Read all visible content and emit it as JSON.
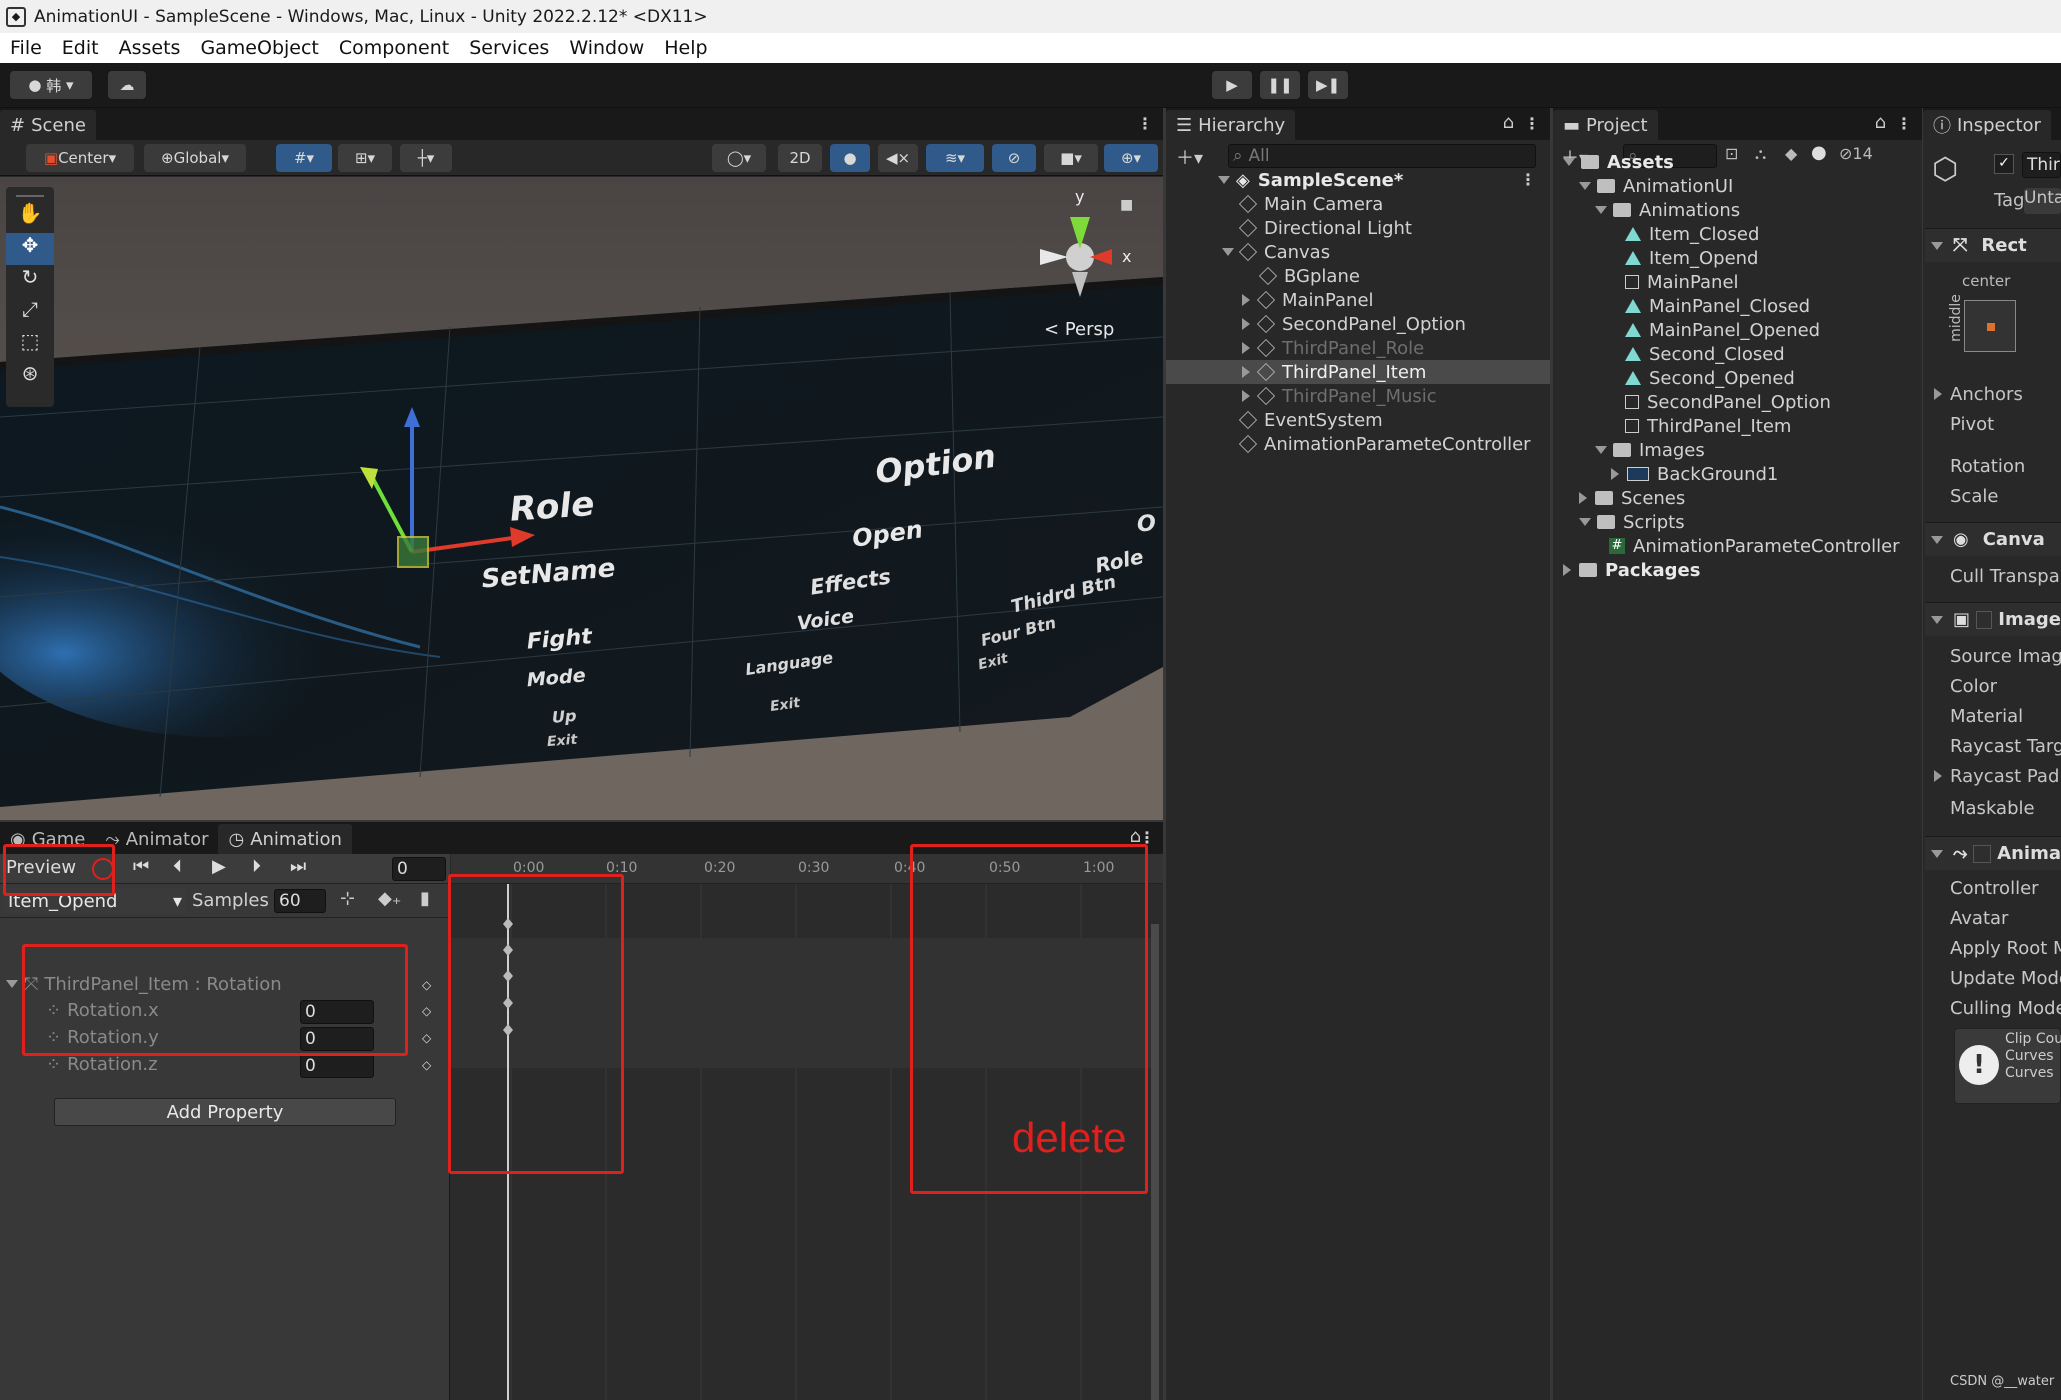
{
  "window": {
    "title": "AnimationUI - SampleScene - Windows, Mac, Linux - Unity 2022.2.12* <DX11>"
  },
  "menu": [
    "File",
    "Edit",
    "Assets",
    "GameObject",
    "Component",
    "Services",
    "Window",
    "Help"
  ],
  "toolbar": {
    "account": "韩",
    "play_icon": "play-icon",
    "pause_icon": "pause-icon",
    "step_icon": "step-icon"
  },
  "scene": {
    "tab": "Scene",
    "pivot": "Center",
    "space": "Global",
    "mode2d": "2D",
    "persp": "Persp",
    "world_labels": [
      "Role",
      "SetName",
      "Fight",
      "Mode",
      "Up",
      "Exit",
      "Option",
      "Open",
      "Effects",
      "Voice",
      "Language",
      "Exit",
      "Role",
      "Thidrd Btn",
      "Four Btn",
      "Exit",
      "O"
    ]
  },
  "bottom_tabs": {
    "game": "Game",
    "animator": "Animator",
    "animation": "Animation"
  },
  "animation": {
    "preview": "Preview",
    "frame": "0",
    "clip": "Item_Opend",
    "samples_label": "Samples",
    "samples": "60",
    "timeline_ticks": [
      "0:00",
      "0:10",
      "0:20",
      "0:30",
      "0:40",
      "0:50",
      "1:00"
    ],
    "group": "ThirdPanel_Item : Rotation",
    "properties": [
      {
        "name": "Rotation.x",
        "value": "0"
      },
      {
        "name": "Rotation.y",
        "value": "0"
      },
      {
        "name": "Rotation.z",
        "value": "0"
      }
    ],
    "add_property": "Add Property",
    "annotation": "delete"
  },
  "hierarchy": {
    "tab": "Hierarchy",
    "search": "All",
    "scene": "SampleScene*",
    "items": [
      {
        "label": "Main Camera",
        "indent": 0,
        "state": "normal"
      },
      {
        "label": "Directional Light",
        "indent": 0,
        "state": "normal"
      },
      {
        "label": "Canvas",
        "indent": 0,
        "state": "open"
      },
      {
        "label": "BGplane",
        "indent": 1,
        "state": "normal"
      },
      {
        "label": "MainPanel",
        "indent": 1,
        "state": "closed"
      },
      {
        "label": "SecondPanel_Option",
        "indent": 1,
        "state": "closed"
      },
      {
        "label": "ThirdPanel_Role",
        "indent": 1,
        "state": "disabled"
      },
      {
        "label": "ThirdPanel_Item",
        "indent": 1,
        "state": "selected"
      },
      {
        "label": "ThirdPanel_Music",
        "indent": 1,
        "state": "disabled"
      },
      {
        "label": "EventSystem",
        "indent": 0,
        "state": "normal"
      },
      {
        "label": "AnimationParameteController",
        "indent": 0,
        "state": "normal"
      }
    ]
  },
  "project": {
    "tab": "Project",
    "hidden_count": "14",
    "items": [
      {
        "label": "Assets",
        "indent": 0,
        "icon": "folder",
        "bold": true
      },
      {
        "label": "AnimationUI",
        "indent": 1,
        "icon": "folder"
      },
      {
        "label": "Animations",
        "indent": 2,
        "icon": "folder"
      },
      {
        "label": "Item_Closed",
        "indent": 3,
        "icon": "anim"
      },
      {
        "label": "Item_Opend",
        "indent": 3,
        "icon": "anim"
      },
      {
        "label": "MainPanel",
        "indent": 3,
        "icon": "ctrl"
      },
      {
        "label": "MainPanel_Closed",
        "indent": 3,
        "icon": "anim"
      },
      {
        "label": "MainPanel_Opened",
        "indent": 3,
        "icon": "anim"
      },
      {
        "label": "Second_Closed",
        "indent": 3,
        "icon": "anim"
      },
      {
        "label": "Second_Opened",
        "indent": 3,
        "icon": "anim"
      },
      {
        "label": "SecondPanel_Option",
        "indent": 3,
        "icon": "ctrl"
      },
      {
        "label": "ThirdPanel_Item",
        "indent": 3,
        "icon": "ctrl"
      },
      {
        "label": "Images",
        "indent": 2,
        "icon": "folder"
      },
      {
        "label": "BackGround1",
        "indent": 3,
        "icon": "image"
      },
      {
        "label": "Scenes",
        "indent": 1,
        "icon": "folder"
      },
      {
        "label": "Scripts",
        "indent": 1,
        "icon": "folder"
      },
      {
        "label": "AnimationParameteController",
        "indent": 2,
        "icon": "script"
      },
      {
        "label": "Packages",
        "indent": 0,
        "icon": "folder",
        "bold": true
      }
    ]
  },
  "inspector": {
    "tab": "Inspector",
    "name": "Thir",
    "tag_label": "Tag",
    "tag_value": "Unta",
    "rect_title": "Rect",
    "center": "center",
    "middle": "middle",
    "rect_rows": [
      "Anchors",
      "Pivot",
      "Rotation",
      "Scale"
    ],
    "canvas_title": "Canva",
    "canvas_rows": [
      "Cull Transpa"
    ],
    "image_title": "Image",
    "image_rows": [
      "Source Image",
      "Color",
      "Material",
      "Raycast Targ",
      "Raycast Pad",
      "Maskable"
    ],
    "animator_title": "Anima",
    "animator_rows": [
      "Controller",
      "Avatar",
      "Apply Root M",
      "Update Mode",
      "Culling Mode"
    ],
    "info_lines": [
      "Clip Cou",
      "Curves",
      "Curves"
    ],
    "watermark": "CSDN @__water"
  }
}
